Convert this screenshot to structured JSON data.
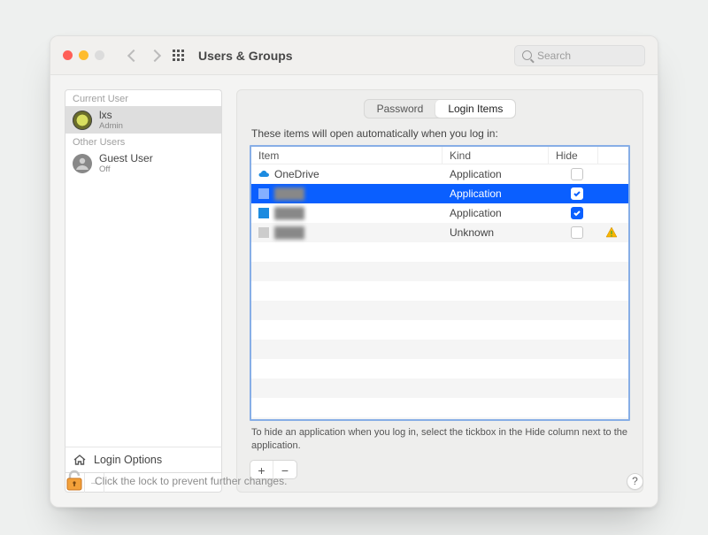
{
  "toolbar": {
    "title": "Users & Groups",
    "search_placeholder": "Search"
  },
  "sidebar": {
    "section_current": "Current User",
    "section_other": "Other Users",
    "users": [
      {
        "name": "lxs",
        "role": "Admin"
      },
      {
        "name": "Guest User",
        "role": "Off"
      }
    ],
    "login_options_label": "Login Options"
  },
  "tabs": {
    "password": "Password",
    "login_items": "Login Items"
  },
  "subtitle": "These items will open automatically when you log in:",
  "table": {
    "headers": {
      "item": "Item",
      "kind": "Kind",
      "hide": "Hide"
    },
    "rows": [
      {
        "item": "OneDrive",
        "kind": "Application",
        "hide": false,
        "blurred": false,
        "selected": false
      },
      {
        "item": "████",
        "kind": "Application",
        "hide": true,
        "blurred": true,
        "selected": true
      },
      {
        "item": "████",
        "kind": "Application",
        "hide": true,
        "blurred": true,
        "selected": false
      },
      {
        "item": "████",
        "kind": "Unknown",
        "hide": false,
        "blurred": true,
        "selected": false,
        "warn": true
      }
    ]
  },
  "hint": "To hide an application when you log in, select the tickbox in the Hide column next to the application.",
  "glyphs": {
    "plus": "+",
    "minus": "−",
    "help": "?"
  },
  "footer": {
    "lock_text": "Click the lock to prevent further changes."
  }
}
